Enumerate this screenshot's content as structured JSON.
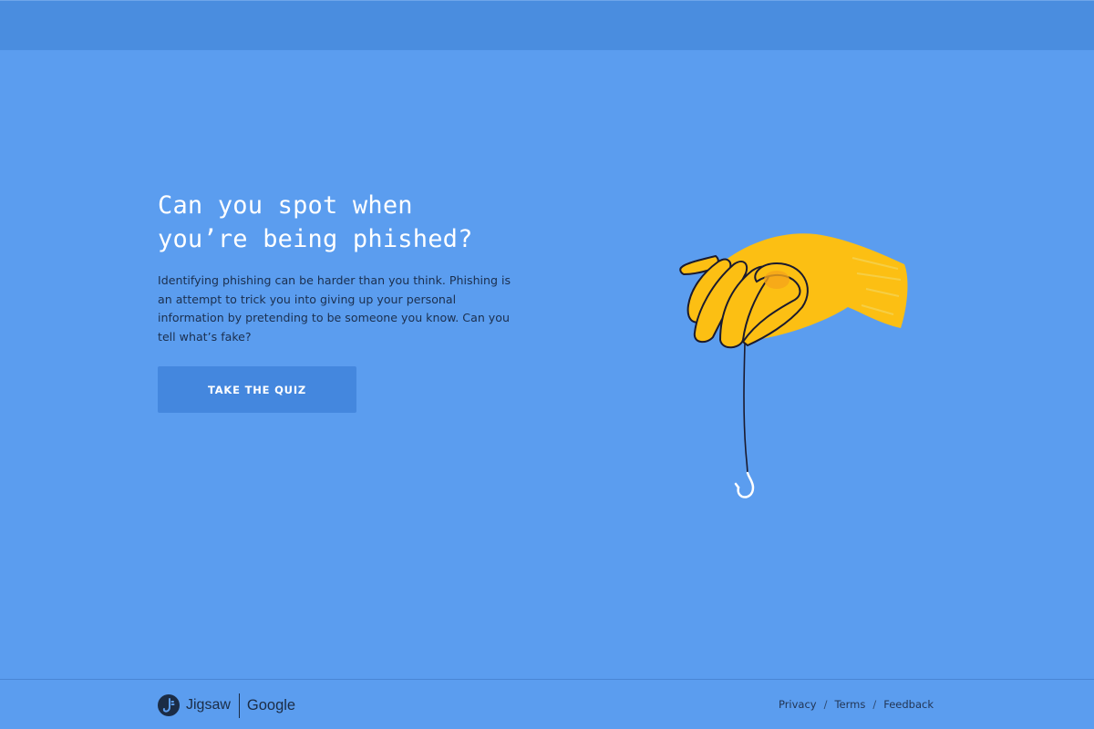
{
  "hero": {
    "title_line1": "Can you spot when",
    "title_line2": "you’re being phished?",
    "description": "Identifying phishing can be harder than you think. Phishing is an attempt to trick you into giving up your personal information by pretending to be someone you know. Can you tell what’s fake?",
    "button_label": "TAKE THE QUIZ"
  },
  "illustration": {
    "subject": "hand-holding-fishing-hook-icon"
  },
  "footer": {
    "brand_jigsaw": "Jigsaw",
    "brand_google": "Google",
    "links": [
      "Privacy",
      "Terms",
      "Feedback"
    ],
    "separator": "/"
  },
  "colors": {
    "background": "#5b9def",
    "top_bar": "#4a8ddf",
    "button": "#4487de",
    "hand": "#fcbf13",
    "text_dark": "#1b2f4e"
  }
}
